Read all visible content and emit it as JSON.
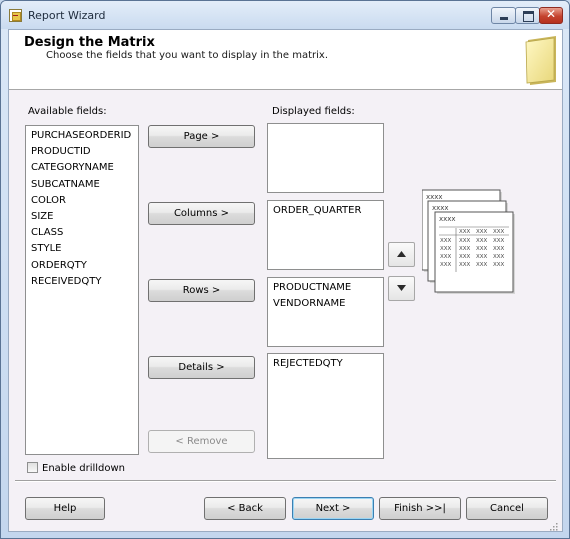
{
  "window": {
    "title": "Report Wizard"
  },
  "header": {
    "title": "Design the Matrix",
    "description": "Choose the fields that you want to display in the matrix."
  },
  "available_fields": {
    "label": "Available fields:",
    "items": [
      "PURCHASEORDERID",
      "PRODUCTID",
      "CATEGORYNAME",
      "SUBCATNAME",
      "COLOR",
      "SIZE",
      "CLASS",
      "STYLE",
      "ORDERQTY",
      "RECEIVEDQTY"
    ]
  },
  "displayed_fields": {
    "label": "Displayed fields:",
    "page": [],
    "columns": [
      "ORDER_QUARTER"
    ],
    "rows": [
      "PRODUCTNAME",
      "VENDORNAME"
    ],
    "details": [
      "REJECTEDQTY"
    ]
  },
  "buttons": {
    "page": "Page >",
    "columns": "Columns >",
    "rows": "Rows >",
    "details": "Details >",
    "remove": "< Remove",
    "help": "Help",
    "back": "< Back",
    "next": "Next >",
    "finish": "Finish >>|",
    "cancel": "Cancel"
  },
  "drilldown": {
    "label": "Enable drilldown",
    "checked": false
  },
  "preview": {
    "header_text": "xxxx",
    "cell_text": "XXX"
  }
}
